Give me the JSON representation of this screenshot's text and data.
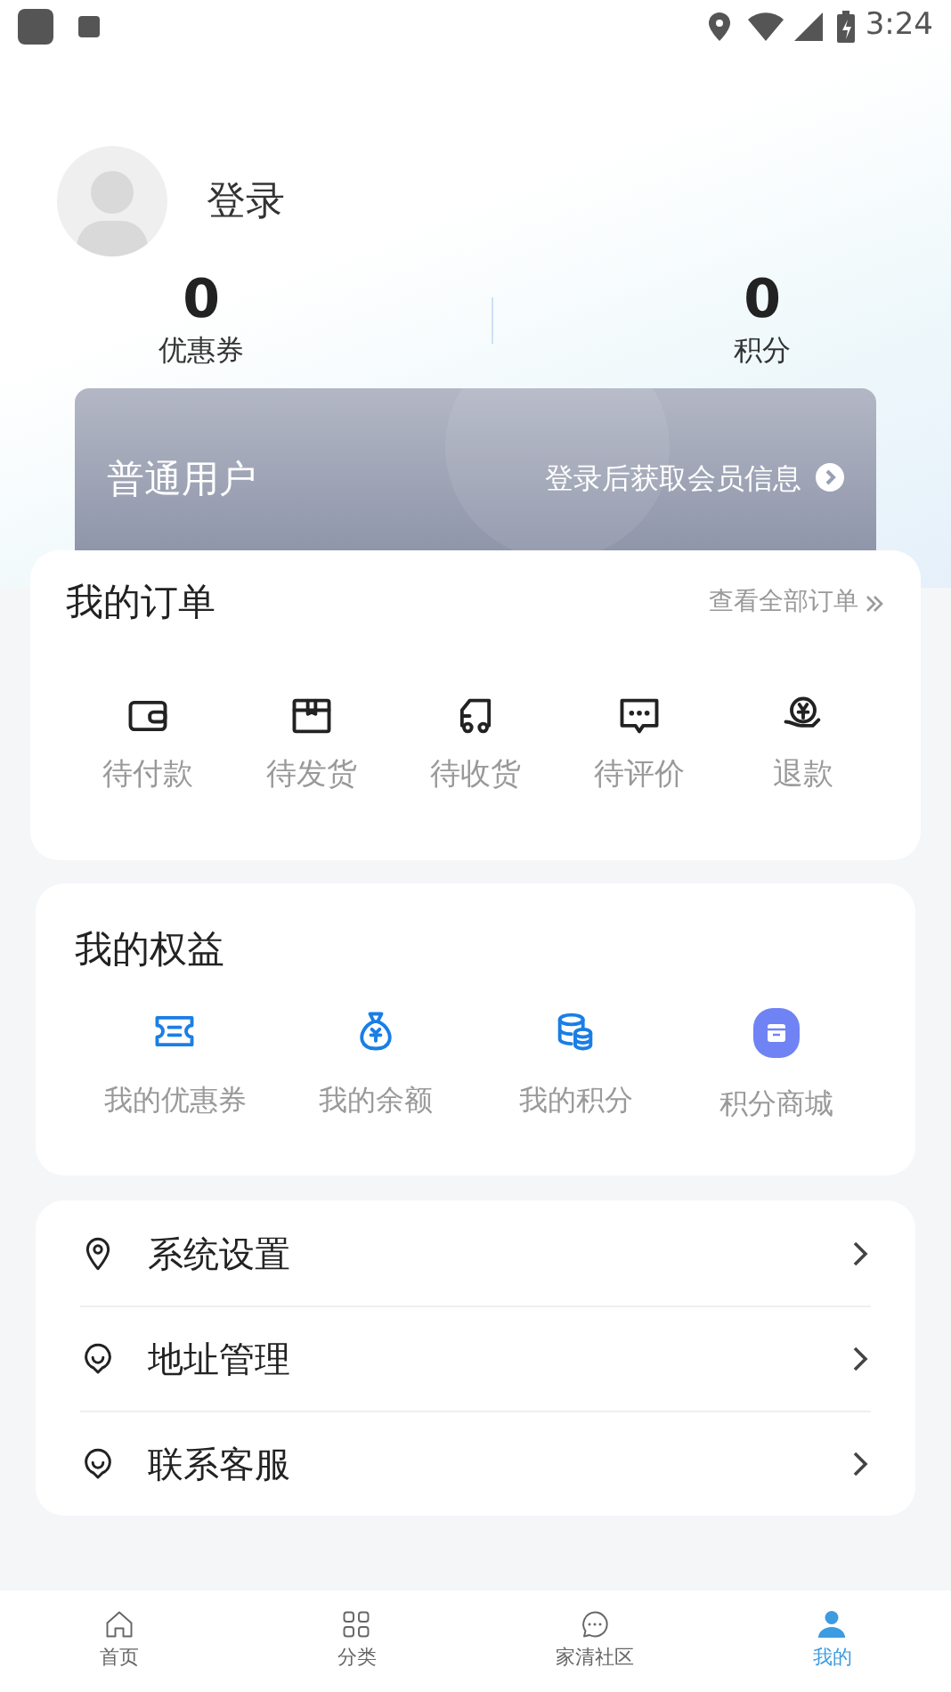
{
  "status_bar": {
    "time": "3:24"
  },
  "profile": {
    "login": "登录"
  },
  "stats": [
    {
      "value": "0",
      "label": "优惠券"
    },
    {
      "value": "0",
      "label": "积分"
    }
  ],
  "member_card": {
    "level": "普通用户",
    "hint": "登录后获取会员信息"
  },
  "orders": {
    "title": "我的订单",
    "view_all": "查看全部订单",
    "items": [
      "待付款",
      "待发货",
      "待收货",
      "待评价",
      "退款"
    ]
  },
  "benefits": {
    "title": "我的权益",
    "items": [
      "我的优惠券",
      "我的余额",
      "我的积分",
      "积分商城"
    ]
  },
  "menu": [
    "系统设置",
    "地址管理",
    "联系客服"
  ],
  "tabs": [
    {
      "label": "首页",
      "selected": false
    },
    {
      "label": "分类",
      "selected": false
    },
    {
      "label": "家清社区",
      "selected": false
    },
    {
      "label": "我的",
      "selected": true
    }
  ]
}
